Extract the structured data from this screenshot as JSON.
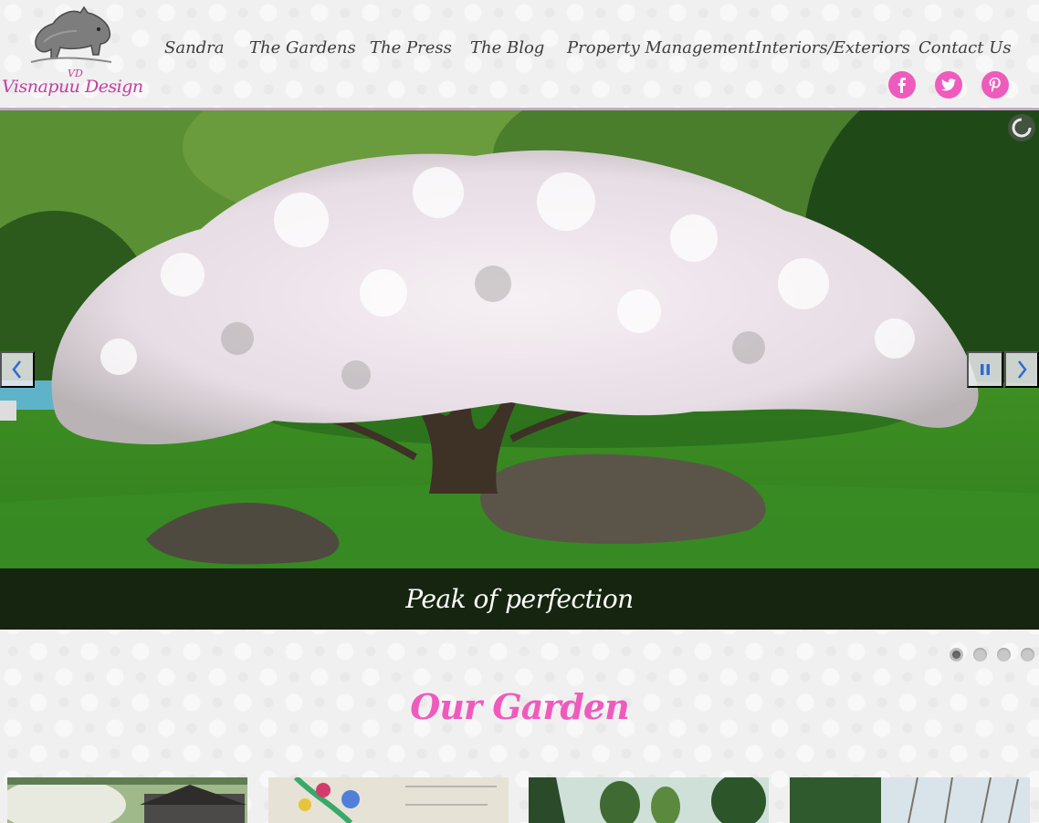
{
  "brand": {
    "monogram": "VD",
    "name": "Visnapuu Design",
    "logo_icon": "boar-icon"
  },
  "nav": {
    "items": [
      {
        "label": "Sandra"
      },
      {
        "label": "The Gardens"
      },
      {
        "label": "The Press"
      },
      {
        "label": "The Blog"
      },
      {
        "label": "Property Management"
      },
      {
        "label": "Interiors/Exteriors"
      },
      {
        "label": "Contact Us"
      }
    ]
  },
  "social": [
    {
      "name": "facebook-icon",
      "glyph": "f"
    },
    {
      "name": "twitter-icon"
    },
    {
      "name": "pinterest-icon"
    }
  ],
  "slider": {
    "caption": "Peak of perfection",
    "prev_icon": "chevron-left-icon",
    "next_icon": "chevron-right-icon",
    "pause_icon": "pause-icon",
    "loader_icon": "loading-spinner-icon",
    "total_slides": 4,
    "active_slide": 1
  },
  "section": {
    "title": "Our Garden"
  },
  "colors": {
    "accent_pink": "#ee5bbd",
    "brand_magenta": "#c03fa6",
    "caption_bg": "#141c0e",
    "nav_text": "#3c3c3c"
  }
}
